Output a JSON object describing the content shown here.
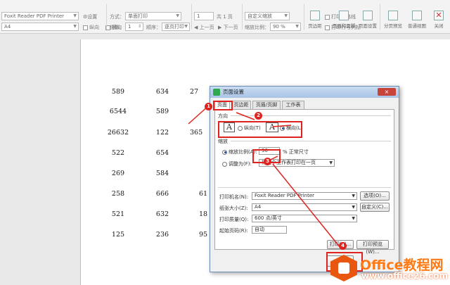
{
  "toolbar": {
    "printer": "Foxit Reader PDF Printer",
    "settings_btn": "设置",
    "paper": "A4",
    "portrait": "纵向",
    "landscape": "横向",
    "mode_label": "方式：",
    "mode_value": "单面打印",
    "copies_label": "份数：",
    "copies_value": "1",
    "order_label": "顺序：",
    "order_value": "逐页打印",
    "page_num": "1",
    "page_total": "共 1 页",
    "prev_page": "上一页",
    "next_page": "下一页",
    "scale_mode": "自定义缩放",
    "scale_label": "缩放比例：",
    "scale_value": "90 %",
    "print_gridlines": "打印网格线",
    "print_headers": "打印行号列标",
    "margins_btn": "页边距",
    "header_footer_btn": "页眉和页脚",
    "page_setup_btn": "页面设置",
    "page_preview_btn": "分页预览",
    "normal_view_btn": "普通视图",
    "close_btn": "关闭"
  },
  "sheet": {
    "col1": [
      "589",
      "6544",
      "26632",
      "522",
      "269",
      "258",
      "521",
      "125"
    ],
    "col2": [
      "634",
      "589",
      "122",
      "654",
      "584",
      "666",
      "632",
      "236"
    ],
    "col3": [
      "27",
      "",
      "365",
      "",
      "",
      "61",
      "18",
      "95"
    ]
  },
  "dialog": {
    "title": "页面设置",
    "close_label": "×",
    "tabs": [
      "页面",
      "页边距",
      "页眉/页脚",
      "工作表"
    ],
    "orientation_heading": "方向",
    "portrait": "纵向(T)",
    "landscape": "横向(L)",
    "scaling_heading": "缩放",
    "scale_label": "缩放比例(A):",
    "scale_value": "90",
    "scale_unit": "% 正常尺寸",
    "fit_label": "调整为(F):",
    "fit_value": "将整个工作表打印在一页",
    "printer_label": "打印机名(N):",
    "printer_value": "Foxit Reader PDF Printer",
    "options_btn": "选项(O)...",
    "paper_label": "纸张大小(Z):",
    "paper_value": "A4",
    "custom_btn": "自定义(C)...",
    "quality_label": "打印质量(Q):",
    "quality_value": "600 点/英寸",
    "first_page_label": "起始页码(R):",
    "first_page_value": "自动",
    "print_btn": "打印(P)...",
    "preview_btn": "打印预览(W)..."
  },
  "annotations": {
    "badges": [
      "1",
      "2",
      "3",
      "4"
    ],
    "color": "#e0231e"
  },
  "watermark": {
    "brand": "Office教程网",
    "url": "www.office26.com"
  }
}
